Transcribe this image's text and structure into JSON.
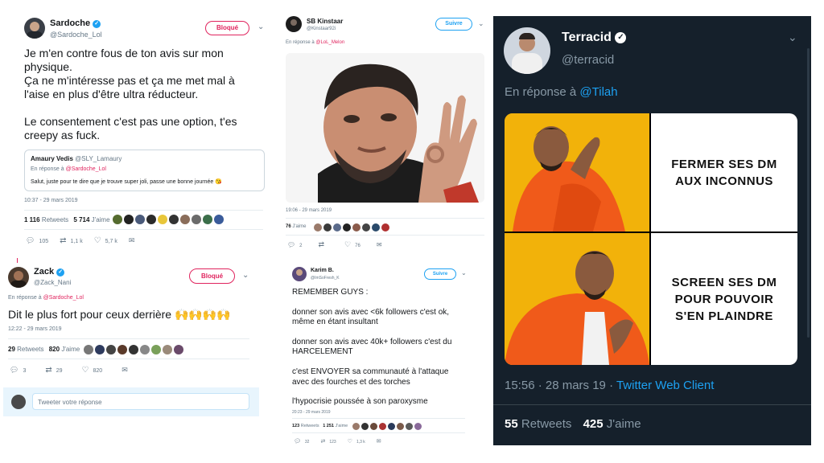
{
  "t1": {
    "name": "Sardoche",
    "handle": "@Sardoche_Lol",
    "block_label": "Bloqué",
    "body": [
      "Je m'en contre fous de ton avis sur mon",
      "physique.",
      "Ça ne m'intéresse pas et ça me met mal à",
      "l'aise en plus d'être ultra réducteur.",
      "",
      "Le consentement c'est pas une option, t'es",
      "creepy as fuck."
    ],
    "quoted": {
      "name": "Amaury Vedis",
      "handle": "@SLY_Lamaury",
      "reply_prefix": "En réponse à",
      "reply_to": "@Sardoche_Lol",
      "text": "Salut, juste pour te dire que je trouve super joli, passe une bonne journée 😘"
    },
    "time": "10:37 - 29 mars 2019",
    "retweets_count": "1 116",
    "retweets_label": "Retweets",
    "likes_count": "5 714",
    "likes_label": "J'aime",
    "actions": {
      "replies": "105",
      "retweets": "1,1 k",
      "likes": "5,7 k"
    }
  },
  "t2": {
    "name": "Zack",
    "handle": "@Zack_Nani",
    "block_label": "Bloqué",
    "reply_prefix": "En réponse à",
    "reply_to": "@Sardoche_Lol",
    "body": "Dit le plus fort pour ceux derrière 🙌🙌🙌🙌",
    "time": "12:22 - 29 mars 2019",
    "retweets_count": "29",
    "retweets_label": "Retweets",
    "likes_count": "820",
    "likes_label": "J'aime",
    "actions": {
      "replies": "3",
      "retweets": "29",
      "likes": "820"
    },
    "reply_placeholder": "Tweeter votre réponse"
  },
  "t3": {
    "name": "SB Kinstaar",
    "handle": "@Kinstaar92i",
    "follow_label": "Suivre",
    "reply_prefix": "En réponse à",
    "reply_to": "@LoL_Melon",
    "time": "19:06 - 29 mars 2019",
    "likes_count": "76",
    "likes_label": "J'aime",
    "actions": {
      "replies": "2",
      "retweets": "",
      "likes": "76"
    }
  },
  "t4": {
    "name": "Karim B.",
    "handle": "@ImSoFresh_K",
    "follow_label": "Suivre",
    "body": [
      "REMEMBER GUYS :",
      "",
      "donner son avis avec <6k followers c'est ok,",
      "même en étant insultant",
      "",
      "donner son avis avec 40k+ followers c'est du",
      "HARCELEMENT",
      "",
      "c'est ENVOYER sa communauté à l'attaque",
      "avec des fourches et des torches",
      "",
      "l'hypocrisie poussée à son paroxysme"
    ],
    "time": "20:23 - 29 mars 2019",
    "retweets_count": "123",
    "retweets_label": "Retweets",
    "likes_count": "1 251",
    "likes_label": "J'aime",
    "actions": {
      "replies": "32",
      "retweets": "123",
      "likes": "1,3 k"
    }
  },
  "t5": {
    "name": "Terracid",
    "handle": "@terracid",
    "reply_prefix": "En réponse à",
    "reply_to": "@Tilah",
    "meme_top": "FERMER SES DM AUX INCONNUS",
    "meme_bottom": "SCREEN SES DM POUR POUVOIR S'EN PLAINDRE",
    "time": "15:56 · 28 mars 19 · ",
    "client": "Twitter Web Client",
    "retweets_count": "55",
    "retweets_label": "Retweets",
    "likes_count": "425",
    "likes_label": "J'aime"
  },
  "colors": {
    "twitter_blue": "#1da1f2",
    "block_red": "#e0245e",
    "dark_bg": "#15202b",
    "meme_yellow": "#f2b20a"
  }
}
